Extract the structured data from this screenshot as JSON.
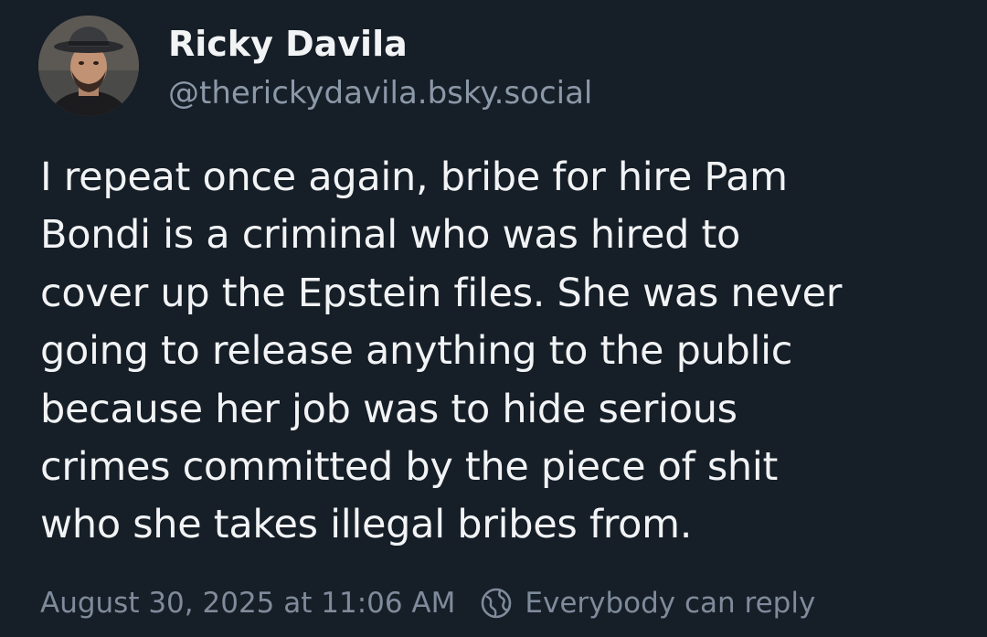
{
  "author": {
    "display_name": "Ricky Davila",
    "handle": "@therickydavila.bsky.social",
    "avatar_icon": "profile-photo"
  },
  "post": {
    "text": "I repeat once again, bribe for hire Pam\nBondi is a criminal who was hired to\ncover up the Epstein files. She was never\ngoing to release anything to the public\nbecause her job was to hide serious\ncrimes committed by the piece of shit\nwho she takes illegal bribes from."
  },
  "meta": {
    "timestamp": "August 30, 2025 at 11:06 AM",
    "reply_setting": "Everybody can reply",
    "reply_setting_icon": "globe-icon"
  },
  "colors": {
    "background": "#161e27",
    "text": "#f1f3f5",
    "muted": "#8b98a8"
  }
}
